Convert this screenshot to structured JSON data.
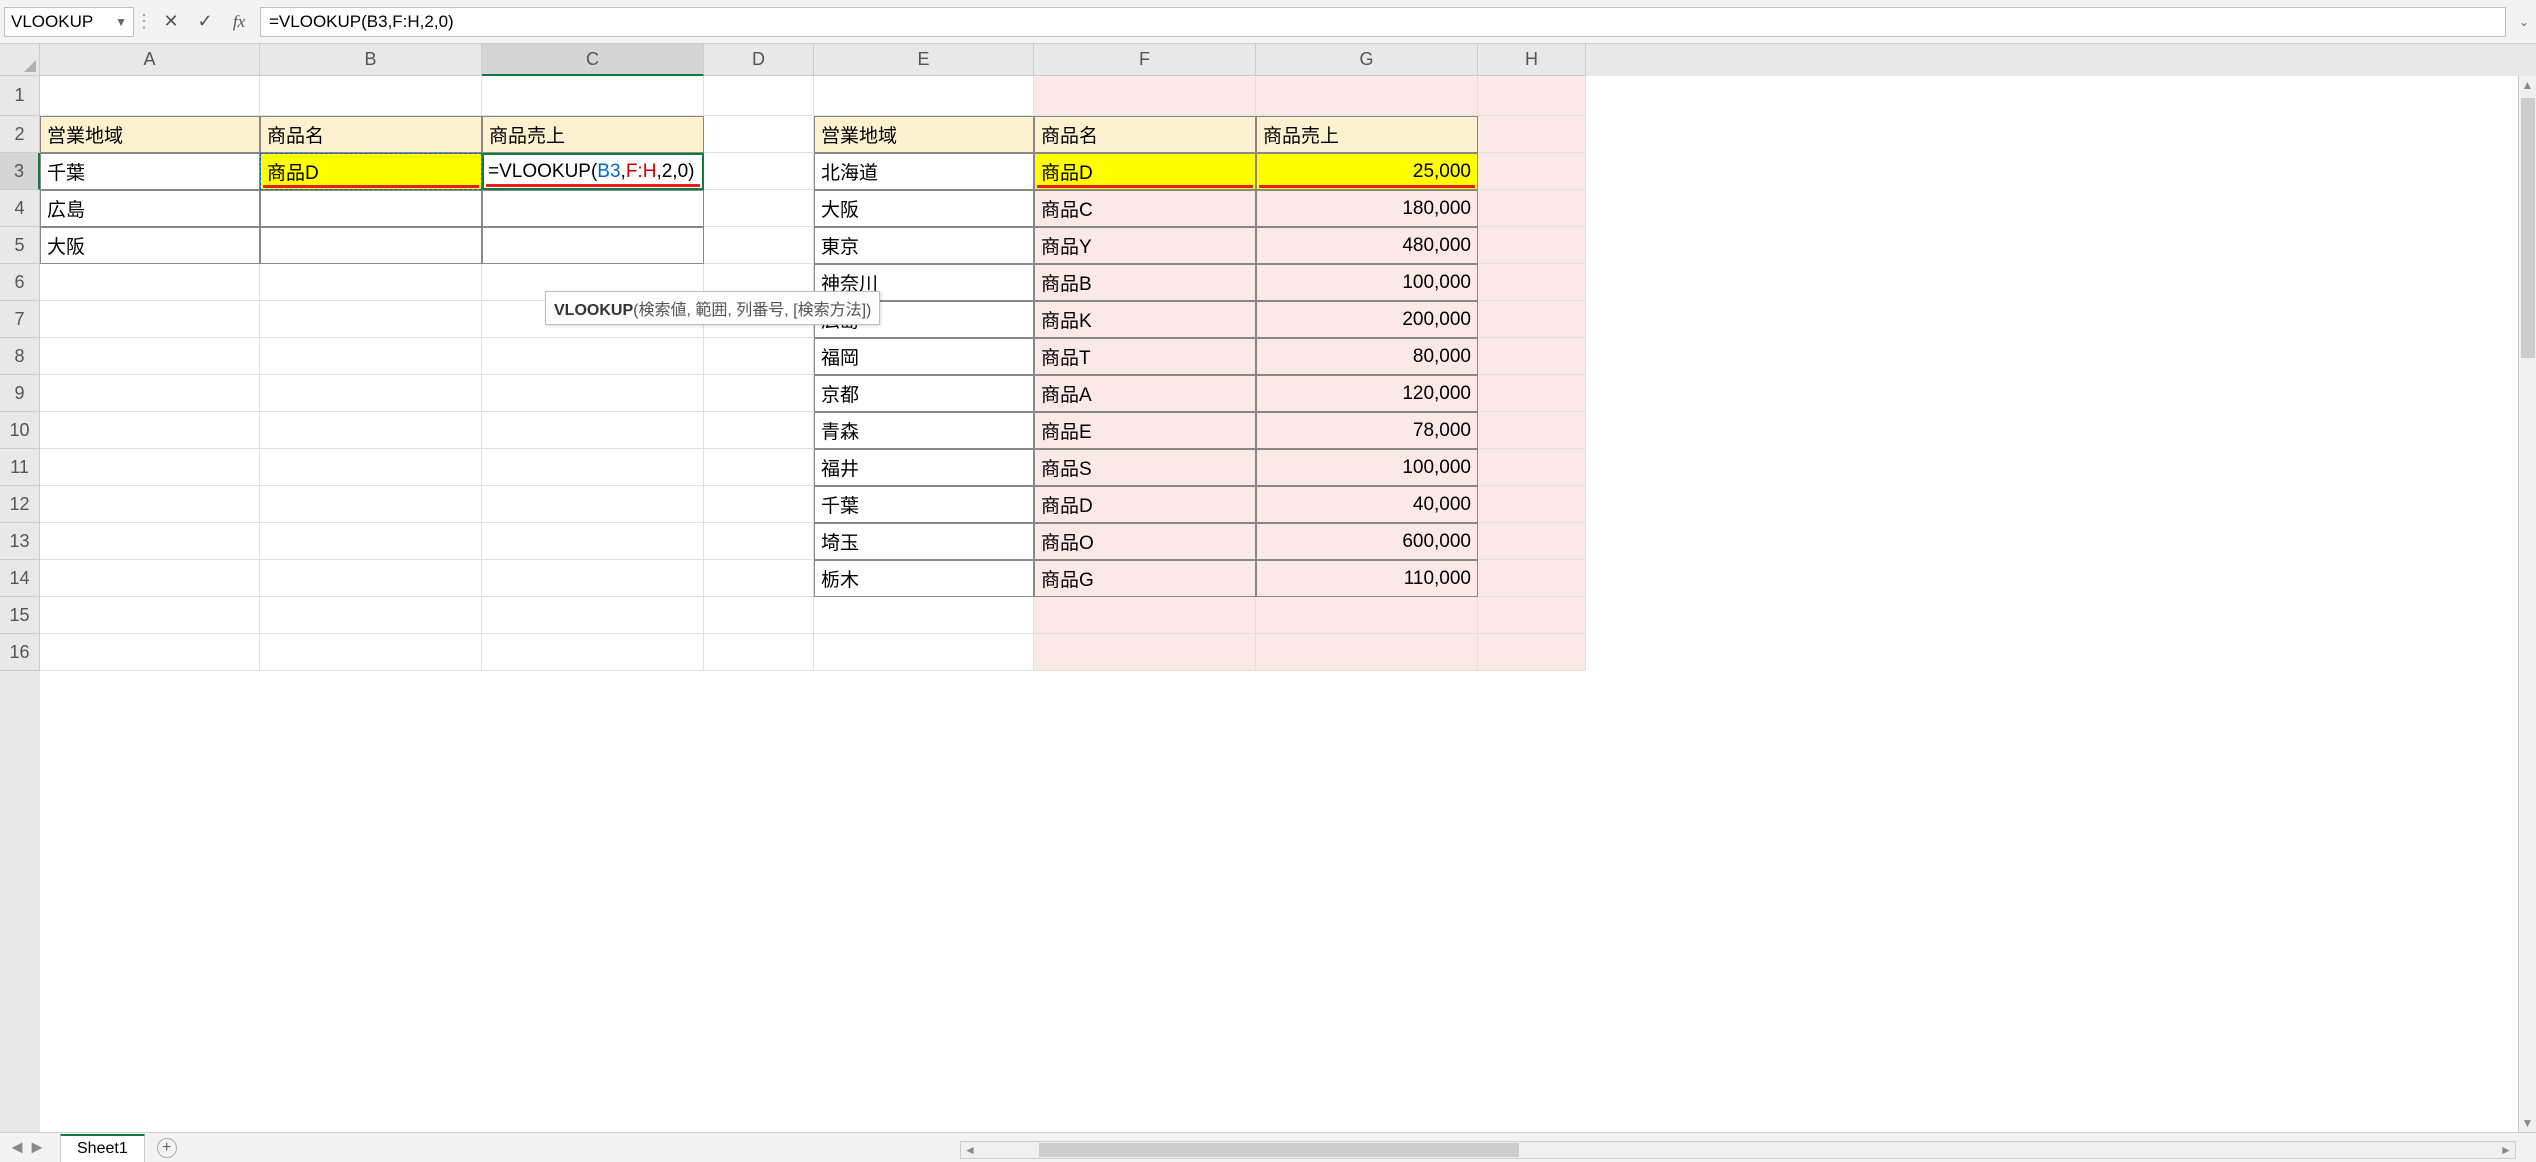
{
  "namebox": {
    "value": "VLOOKUP"
  },
  "formula_bar": {
    "text": "=VLOOKUP(B3,F:H,2,0)"
  },
  "tooltip": {
    "fn": "VLOOKUP",
    "args": "(検索値, 範囲, 列番号, [検索方法])"
  },
  "columns": [
    "A",
    "B",
    "C",
    "D",
    "E",
    "F",
    "G",
    "H"
  ],
  "active_col": "C",
  "active_row": 3,
  "rows_shown": 16,
  "left_table": {
    "headers": {
      "region": "営業地域",
      "product": "商品名",
      "sales": "商品売上"
    },
    "rows": [
      {
        "region": "千葉",
        "product": "商品D",
        "sales_formula_parts": {
          "pre": "=VLOOKUP(",
          "arg1": "B3",
          "sep1": ",",
          "arg2": "F:H",
          "sep2": ",",
          "arg3": "2",
          "sep3": ",",
          "arg4": "0",
          "post": ")"
        }
      },
      {
        "region": "広島",
        "product": "",
        "sales": ""
      },
      {
        "region": "大阪",
        "product": "",
        "sales": ""
      }
    ]
  },
  "right_table": {
    "headers": {
      "region": "営業地域",
      "product": "商品名",
      "sales": "商品売上"
    },
    "rows": [
      {
        "region": "北海道",
        "product": "商品D",
        "sales": "25,000"
      },
      {
        "region": "大阪",
        "product": "商品C",
        "sales": "180,000"
      },
      {
        "region": "東京",
        "product": "商品Y",
        "sales": "480,000"
      },
      {
        "region": "神奈川",
        "product": "商品B",
        "sales": "100,000"
      },
      {
        "region": "広島",
        "product": "商品K",
        "sales": "200,000"
      },
      {
        "region": "福岡",
        "product": "商品T",
        "sales": "80,000"
      },
      {
        "region": "京都",
        "product": "商品A",
        "sales": "120,000"
      },
      {
        "region": "青森",
        "product": "商品E",
        "sales": "78,000"
      },
      {
        "region": "福井",
        "product": "商品S",
        "sales": "100,000"
      },
      {
        "region": "千葉",
        "product": "商品D",
        "sales": "40,000"
      },
      {
        "region": "埼玉",
        "product": "商品O",
        "sales": "600,000"
      },
      {
        "region": "栃木",
        "product": "商品G",
        "sales": "110,000"
      }
    ]
  },
  "sheet_tabs": {
    "active": "Sheet1"
  },
  "chart_data": {
    "type": "table",
    "tables": [
      {
        "name": "left",
        "columns": [
          "営業地域",
          "商品名",
          "商品売上"
        ],
        "rows": [
          [
            "千葉",
            "商品D",
            "=VLOOKUP(B3,F:H,2,0)"
          ],
          [
            "広島",
            "",
            ""
          ],
          [
            "大阪",
            "",
            ""
          ]
        ]
      },
      {
        "name": "right",
        "columns": [
          "営業地域",
          "商品名",
          "商品売上"
        ],
        "rows": [
          [
            "北海道",
            "商品D",
            25000
          ],
          [
            "大阪",
            "商品C",
            180000
          ],
          [
            "東京",
            "商品Y",
            480000
          ],
          [
            "神奈川",
            "商品B",
            100000
          ],
          [
            "広島",
            "商品K",
            200000
          ],
          [
            "福岡",
            "商品T",
            80000
          ],
          [
            "京都",
            "商品A",
            120000
          ],
          [
            "青森",
            "商品E",
            78000
          ],
          [
            "福井",
            "商品S",
            100000
          ],
          [
            "千葉",
            "商品D",
            40000
          ],
          [
            "埼玉",
            "商品O",
            600000
          ],
          [
            "栃木",
            "商品G",
            110000
          ]
        ]
      }
    ]
  }
}
